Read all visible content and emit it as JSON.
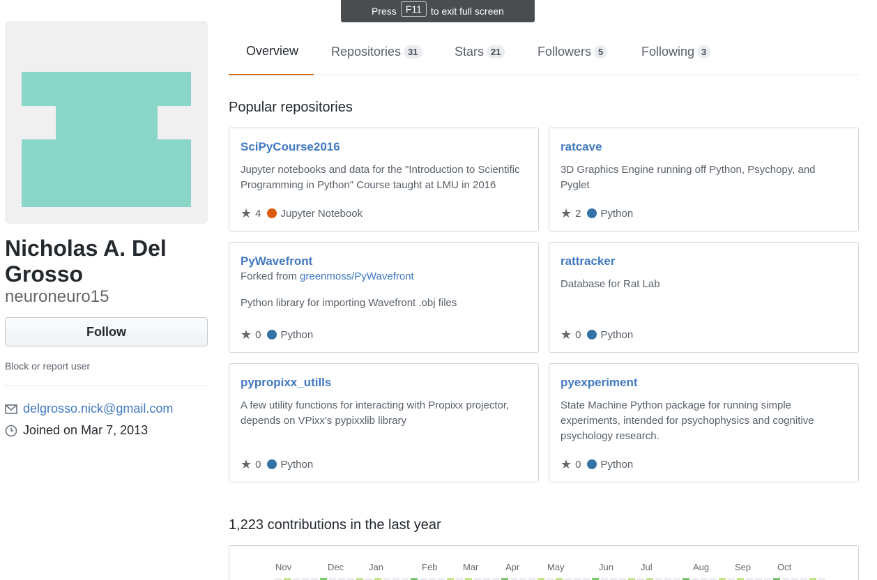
{
  "fullscreen_toast": {
    "press": "Press",
    "key": "F11",
    "rest": "to exit full screen"
  },
  "profile": {
    "full_name": "Nicholas A. Del Grosso",
    "username": "neuroneuro15",
    "follow_label": "Follow",
    "block_label": "Block or report user",
    "email": "delgrosso.nick@gmail.com",
    "joined": "Joined on Mar 7, 2013",
    "avatar_color": "#8ad6c9"
  },
  "tabs": [
    {
      "label": "Overview",
      "count": ""
    },
    {
      "label": "Repositories",
      "count": "31"
    },
    {
      "label": "Stars",
      "count": "21"
    },
    {
      "label": "Followers",
      "count": "5"
    },
    {
      "label": "Following",
      "count": "3"
    }
  ],
  "popular": {
    "title": "Popular repositories",
    "repos": [
      {
        "name": "SciPyCourse2016",
        "desc": "Jupyter notebooks and data for the \"Introduction to Scientific Programming in Python\" Course taught at LMU in 2016",
        "stars": "4",
        "language": "Jupyter Notebook",
        "lang_color": "#da5b0b"
      },
      {
        "name": "ratcave",
        "desc": "3D Graphics Engine running off Python, Psychopy, and Pyglet",
        "stars": "2",
        "language": "Python",
        "lang_color": "#3572A5"
      },
      {
        "name": "PyWavefront",
        "forked_prefix": "Forked from",
        "forked_from": "greenmoss/PyWavefront",
        "desc": "Python library for importing Wavefront .obj files",
        "stars": "0",
        "language": "Python",
        "lang_color": "#3572A5"
      },
      {
        "name": "rattracker",
        "desc": "Database for Rat Lab",
        "stars": "0",
        "language": "Python",
        "lang_color": "#3572A5"
      },
      {
        "name": "pypropixx_utills",
        "desc": "A few utility functions for interacting with Propixx projector, depends on VPixx's pypixxlib library",
        "stars": "0",
        "language": "Python",
        "lang_color": "#3572A5"
      },
      {
        "name": "pyexperiment",
        "desc": "State Machine Python package for running simple experiments, intended for psychophysics and cognitive psychology research.",
        "stars": "0",
        "language": "Python",
        "lang_color": "#3572A5"
      }
    ]
  },
  "contributions": {
    "title": "1,223 contributions in the last year",
    "months": [
      "Nov",
      "Dec",
      "Jan",
      "Feb",
      "Mar",
      "Apr",
      "May",
      "Jun",
      "Jul",
      "Aug",
      "Sep",
      "Oct"
    ]
  }
}
